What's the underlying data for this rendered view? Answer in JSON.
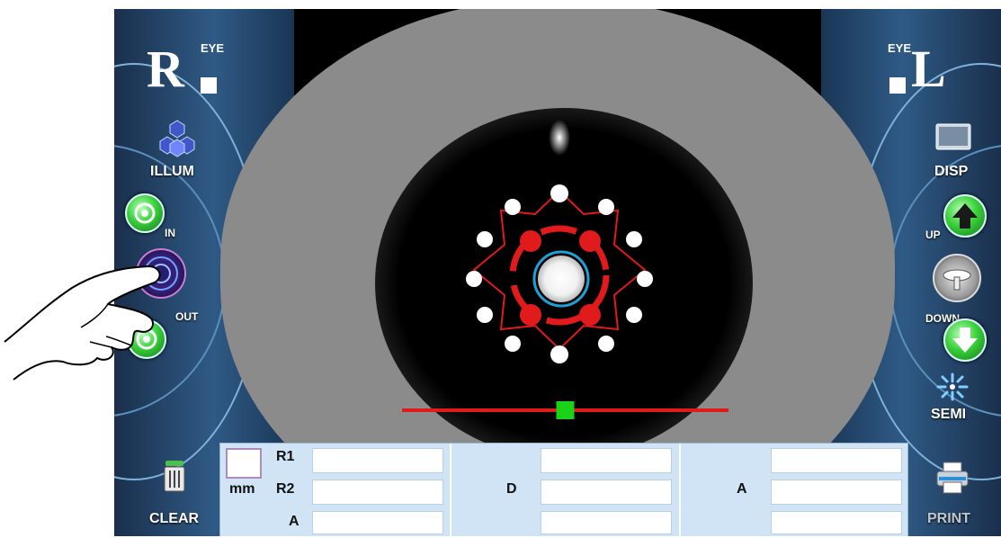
{
  "left_panel": {
    "eye_logo": {
      "letter": "R",
      "eye_text": "EYE"
    },
    "illum_label": "ILLUM",
    "in_label": "IN",
    "out_label": "OUT",
    "clear_label": "CLEAR"
  },
  "right_panel": {
    "eye_logo": {
      "letter": "L",
      "eye_text": "EYE"
    },
    "disp_label": "DISP",
    "up_label": "UP",
    "down_label": "DOWN",
    "semi_label": "SEMI",
    "print_label": "PRINT"
  },
  "measurement": {
    "unit_label": "mm",
    "left_rows": [
      "R1",
      "R2",
      "A"
    ],
    "left_values": [
      "",
      "",
      ""
    ],
    "middle_label": "D",
    "middle_values": [
      "",
      "",
      ""
    ],
    "right_label": "A",
    "right_values": [
      "",
      "",
      ""
    ]
  },
  "alignment": {
    "slider_position": 0.5
  },
  "colors": {
    "target_red": "#e11b1b",
    "slider_green": "#18d318",
    "pupil_ring": "#1ea0d8",
    "panel_blue": "#2f5a85"
  },
  "icons": {
    "illum": "illumination-hex-icon",
    "in": "aperture-in-icon",
    "joystick": "joystick-icon",
    "out": "aperture-out-icon",
    "clear": "trash-icon",
    "disp": "monitor-icon",
    "up": "arrow-up-icon",
    "chinrest": "chinrest-icon",
    "down": "arrow-down-icon",
    "semi": "semi-auto-icon",
    "print": "printer-icon"
  }
}
